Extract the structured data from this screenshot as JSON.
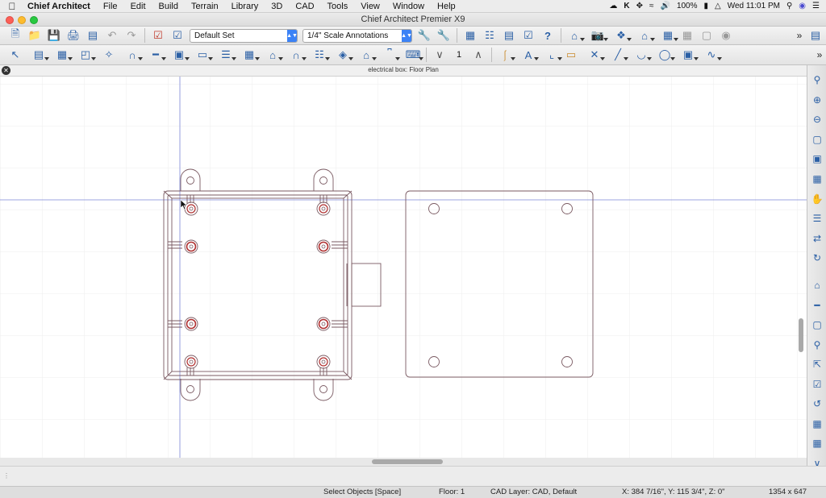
{
  "menubar": {
    "app": "Chief Architect",
    "items": [
      "File",
      "Edit",
      "Build",
      "Terrain",
      "Library",
      "3D",
      "CAD",
      "Tools",
      "View",
      "Window",
      "Help"
    ],
    "battery": "100%",
    "clock": "Wed 11:01 PM"
  },
  "window": {
    "title": "Chief Architect Premier X9"
  },
  "toolbar": {
    "layer_set": "Default Set",
    "annotation_set": "1/4\" Scale Annotations",
    "floor_number": "1"
  },
  "view": {
    "tab_label": "electrical box: Floor Plan"
  },
  "status": {
    "mode": "Select Objects [Space]",
    "floor": "Floor: 1",
    "cad_layer": "CAD Layer: CAD,  Default",
    "coords": "X: 384 7/16\", Y: 115 3/4\", Z: 0\"",
    "size": "1354 x 647"
  },
  "colors": {
    "accent": "#2a5fa5",
    "drawing_line": "#7a5a62",
    "screw_red": "#b03030",
    "guide_line": "#7b86d6"
  }
}
